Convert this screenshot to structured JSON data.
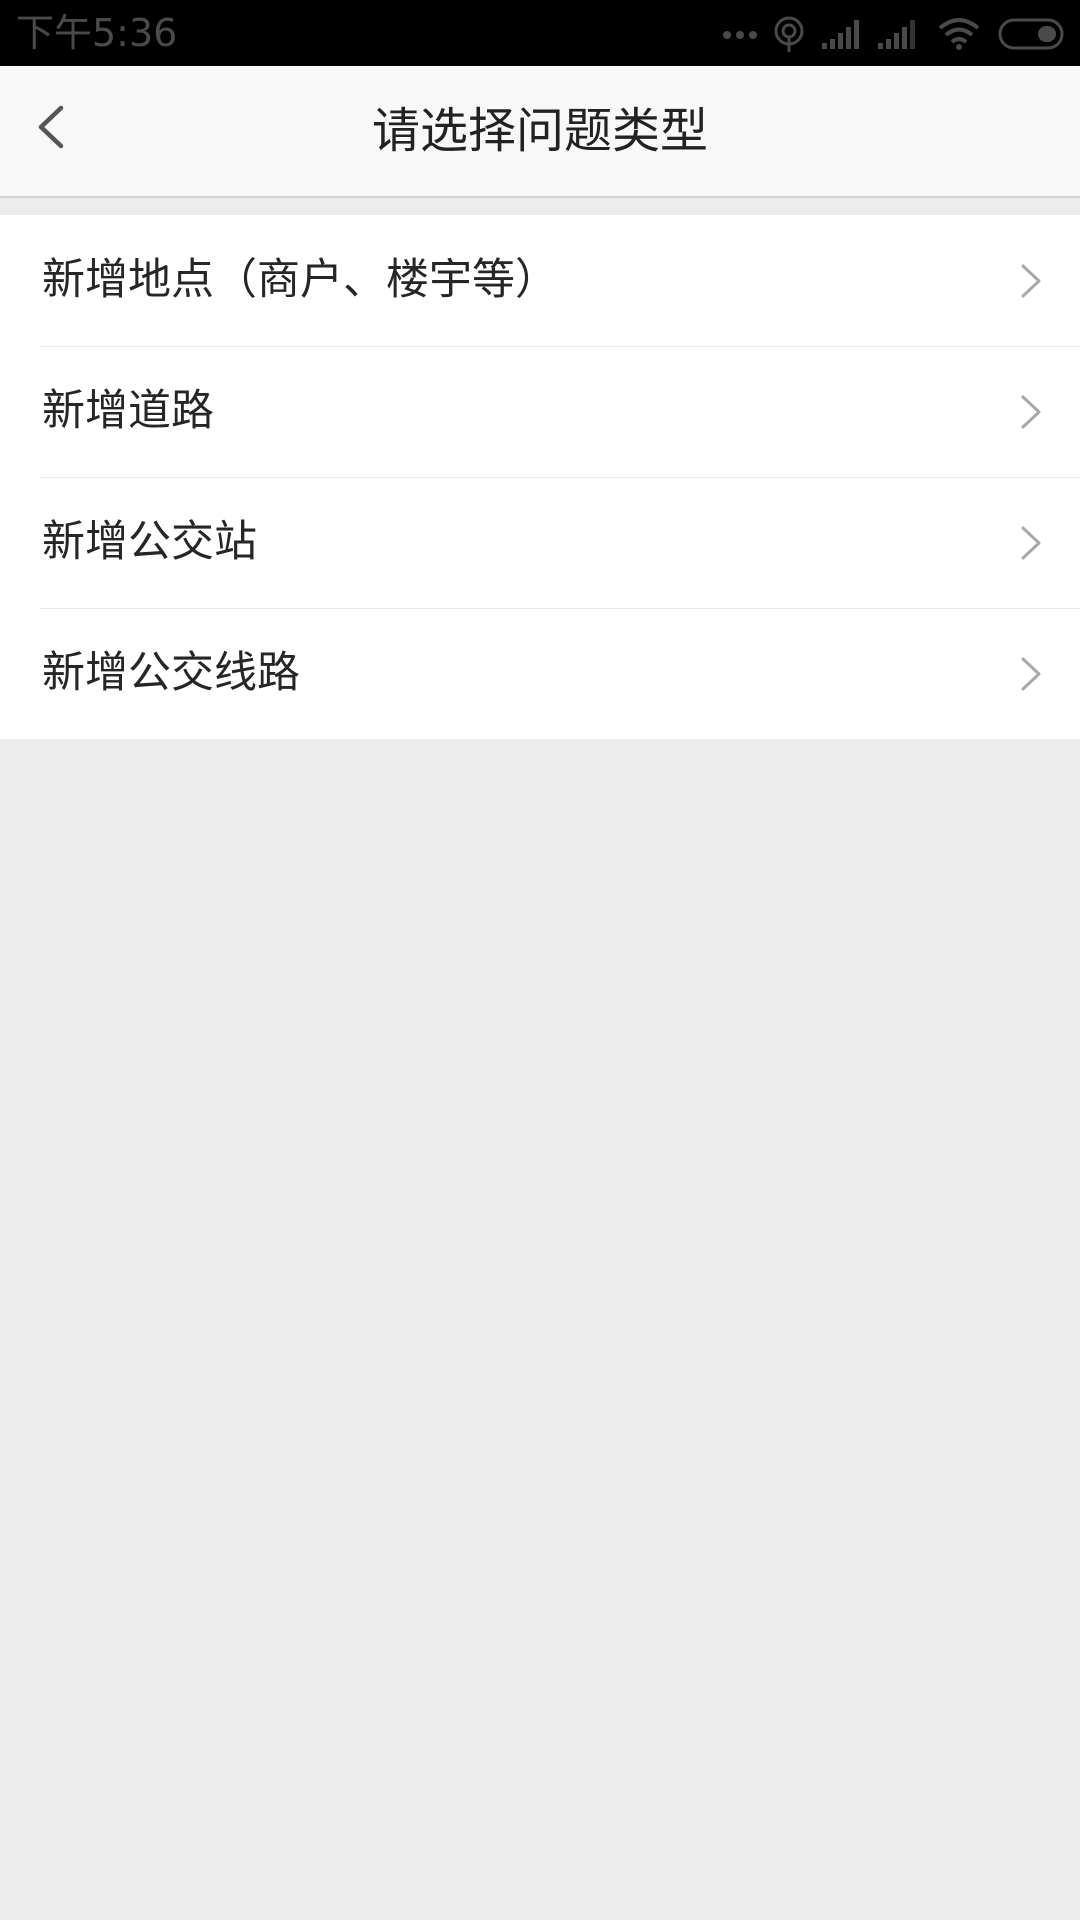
{
  "status_bar": {
    "time": "下午5:36",
    "icons": [
      "more-dots-icon",
      "hotspot-icon",
      "signal-icon",
      "signal-icon",
      "wifi-icon",
      "battery-icon"
    ]
  },
  "nav": {
    "title": "请选择问题类型",
    "back_icon": "chevron-left-icon"
  },
  "list": {
    "items": [
      {
        "label": "新增地点（商户、楼宇等）"
      },
      {
        "label": "新增道路"
      },
      {
        "label": "新增公交站"
      },
      {
        "label": "新增公交线路"
      }
    ],
    "chevron_icon": "chevron-right-icon"
  },
  "colors": {
    "status_bar_bg": "#000000",
    "nav_bg": "#f8f8f8",
    "page_bg": "#ececec",
    "list_bg": "#ffffff",
    "title_text": "#222222",
    "item_text": "#262626",
    "chevron": "#a8a8a8"
  }
}
